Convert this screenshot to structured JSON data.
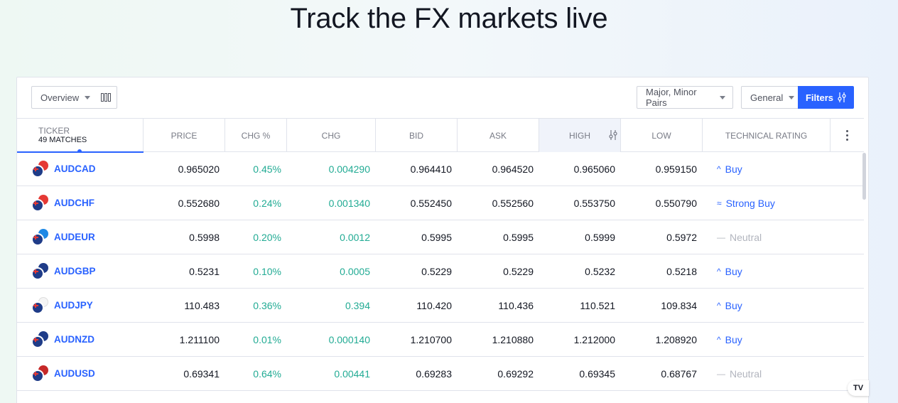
{
  "page": {
    "title": "Track the FX markets live"
  },
  "toolbar": {
    "view_label": "Overview",
    "pairs_label": "Major, Minor Pairs",
    "general_label": "General",
    "filters_label": "Filters"
  },
  "table": {
    "headers": {
      "ticker": "TICKER",
      "matches": "49 MATCHES",
      "price": "PRICE",
      "chg_pct": "CHG %",
      "chg": "CHG",
      "bid": "BID",
      "ask": "ASK",
      "high": "HIGH",
      "low": "LOW",
      "rating": "TECHNICAL RATING"
    },
    "rows": [
      {
        "symbol": "AUDCAD",
        "flag_color": "#e53935",
        "price": "0.965020",
        "chg_pct": "0.45%",
        "chg": "0.004290",
        "bid": "0.964410",
        "ask": "0.964520",
        "high": "0.965060",
        "low": "0.959150",
        "rating": "Buy",
        "rating_icon": "^",
        "rating_type": "buy"
      },
      {
        "symbol": "AUDCHF",
        "flag_color": "#e53935",
        "price": "0.552680",
        "chg_pct": "0.24%",
        "chg": "0.001340",
        "bid": "0.552450",
        "ask": "0.552560",
        "high": "0.553750",
        "low": "0.550790",
        "rating": "Strong Buy",
        "rating_icon": "≈",
        "rating_type": "buy"
      },
      {
        "symbol": "AUDEUR",
        "flag_color": "#1e88e5",
        "price": "0.5998",
        "chg_pct": "0.20%",
        "chg": "0.0012",
        "bid": "0.5995",
        "ask": "0.5995",
        "high": "0.5999",
        "low": "0.5972",
        "rating": "Neutral",
        "rating_icon": "—",
        "rating_type": "neutral"
      },
      {
        "symbol": "AUDGBP",
        "flag_color": "#1f3c88",
        "price": "0.5231",
        "chg_pct": "0.10%",
        "chg": "0.0005",
        "bid": "0.5229",
        "ask": "0.5229",
        "high": "0.5232",
        "low": "0.5218",
        "rating": "Buy",
        "rating_icon": "^",
        "rating_type": "buy"
      },
      {
        "symbol": "AUDJPY",
        "flag_color": "#f5f5f5",
        "price": "110.483",
        "chg_pct": "0.36%",
        "chg": "0.394",
        "bid": "110.420",
        "ask": "110.436",
        "high": "110.521",
        "low": "109.834",
        "rating": "Buy",
        "rating_icon": "^",
        "rating_type": "buy"
      },
      {
        "symbol": "AUDNZD",
        "flag_color": "#1f3c88",
        "price": "1.211100",
        "chg_pct": "0.01%",
        "chg": "0.000140",
        "bid": "1.210700",
        "ask": "1.210880",
        "high": "1.212000",
        "low": "1.208920",
        "rating": "Buy",
        "rating_icon": "^",
        "rating_type": "buy"
      },
      {
        "symbol": "AUDUSD",
        "flag_color": "#c62828",
        "price": "0.69341",
        "chg_pct": "0.64%",
        "chg": "0.00441",
        "bid": "0.69283",
        "ask": "0.69292",
        "high": "0.69345",
        "low": "0.68767",
        "rating": "Neutral",
        "rating_icon": "—",
        "rating_type": "neutral"
      }
    ]
  },
  "brand": {
    "logo_text": "TV"
  }
}
